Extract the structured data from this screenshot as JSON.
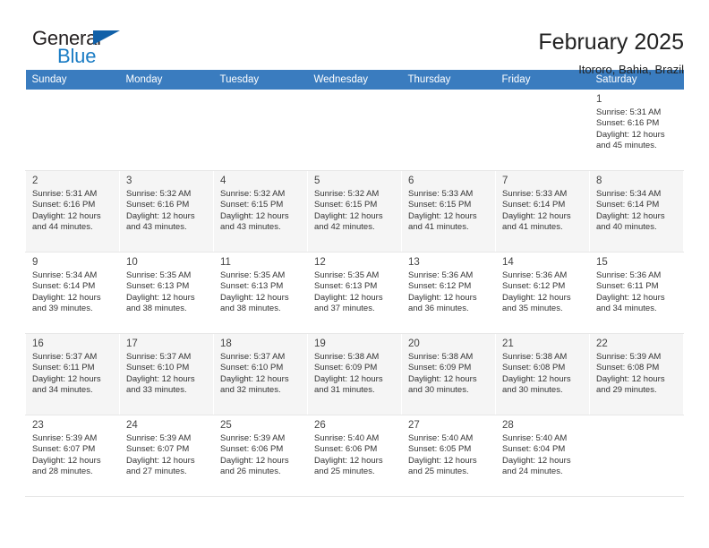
{
  "brand": {
    "name_part1": "General",
    "name_part2": "Blue",
    "logo_icon": "blue-triangle-logo"
  },
  "header": {
    "title": "February 2025",
    "subtitle": "Itororo, Bahia, Brazil"
  },
  "colors": {
    "header_row_bg": "#3a7cbf",
    "brand_blue": "#1a7cc4",
    "shaded_row_bg": "#f5f5f5",
    "cell_border": "#e7e7e7"
  },
  "weekday_headers": [
    "Sunday",
    "Monday",
    "Tuesday",
    "Wednesday",
    "Thursday",
    "Friday",
    "Saturday"
  ],
  "weeks": [
    {
      "shaded": false,
      "days": [
        {
          "day": "",
          "sunrise": "",
          "sunset": "",
          "daylight_line1": "",
          "daylight_line2": "",
          "empty": true
        },
        {
          "day": "",
          "sunrise": "",
          "sunset": "",
          "daylight_line1": "",
          "daylight_line2": "",
          "empty": true
        },
        {
          "day": "",
          "sunrise": "",
          "sunset": "",
          "daylight_line1": "",
          "daylight_line2": "",
          "empty": true
        },
        {
          "day": "",
          "sunrise": "",
          "sunset": "",
          "daylight_line1": "",
          "daylight_line2": "",
          "empty": true
        },
        {
          "day": "",
          "sunrise": "",
          "sunset": "",
          "daylight_line1": "",
          "daylight_line2": "",
          "empty": true
        },
        {
          "day": "",
          "sunrise": "",
          "sunset": "",
          "daylight_line1": "",
          "daylight_line2": "",
          "empty": true
        },
        {
          "day": "1",
          "sunrise": "Sunrise: 5:31 AM",
          "sunset": "Sunset: 6:16 PM",
          "daylight_line1": "Daylight: 12 hours",
          "daylight_line2": "and 45 minutes.",
          "empty": false
        }
      ]
    },
    {
      "shaded": true,
      "days": [
        {
          "day": "2",
          "sunrise": "Sunrise: 5:31 AM",
          "sunset": "Sunset: 6:16 PM",
          "daylight_line1": "Daylight: 12 hours",
          "daylight_line2": "and 44 minutes.",
          "empty": false
        },
        {
          "day": "3",
          "sunrise": "Sunrise: 5:32 AM",
          "sunset": "Sunset: 6:16 PM",
          "daylight_line1": "Daylight: 12 hours",
          "daylight_line2": "and 43 minutes.",
          "empty": false
        },
        {
          "day": "4",
          "sunrise": "Sunrise: 5:32 AM",
          "sunset": "Sunset: 6:15 PM",
          "daylight_line1": "Daylight: 12 hours",
          "daylight_line2": "and 43 minutes.",
          "empty": false
        },
        {
          "day": "5",
          "sunrise": "Sunrise: 5:32 AM",
          "sunset": "Sunset: 6:15 PM",
          "daylight_line1": "Daylight: 12 hours",
          "daylight_line2": "and 42 minutes.",
          "empty": false
        },
        {
          "day": "6",
          "sunrise": "Sunrise: 5:33 AM",
          "sunset": "Sunset: 6:15 PM",
          "daylight_line1": "Daylight: 12 hours",
          "daylight_line2": "and 41 minutes.",
          "empty": false
        },
        {
          "day": "7",
          "sunrise": "Sunrise: 5:33 AM",
          "sunset": "Sunset: 6:14 PM",
          "daylight_line1": "Daylight: 12 hours",
          "daylight_line2": "and 41 minutes.",
          "empty": false
        },
        {
          "day": "8",
          "sunrise": "Sunrise: 5:34 AM",
          "sunset": "Sunset: 6:14 PM",
          "daylight_line1": "Daylight: 12 hours",
          "daylight_line2": "and 40 minutes.",
          "empty": false
        }
      ]
    },
    {
      "shaded": false,
      "days": [
        {
          "day": "9",
          "sunrise": "Sunrise: 5:34 AM",
          "sunset": "Sunset: 6:14 PM",
          "daylight_line1": "Daylight: 12 hours",
          "daylight_line2": "and 39 minutes.",
          "empty": false
        },
        {
          "day": "10",
          "sunrise": "Sunrise: 5:35 AM",
          "sunset": "Sunset: 6:13 PM",
          "daylight_line1": "Daylight: 12 hours",
          "daylight_line2": "and 38 minutes.",
          "empty": false
        },
        {
          "day": "11",
          "sunrise": "Sunrise: 5:35 AM",
          "sunset": "Sunset: 6:13 PM",
          "daylight_line1": "Daylight: 12 hours",
          "daylight_line2": "and 38 minutes.",
          "empty": false
        },
        {
          "day": "12",
          "sunrise": "Sunrise: 5:35 AM",
          "sunset": "Sunset: 6:13 PM",
          "daylight_line1": "Daylight: 12 hours",
          "daylight_line2": "and 37 minutes.",
          "empty": false
        },
        {
          "day": "13",
          "sunrise": "Sunrise: 5:36 AM",
          "sunset": "Sunset: 6:12 PM",
          "daylight_line1": "Daylight: 12 hours",
          "daylight_line2": "and 36 minutes.",
          "empty": false
        },
        {
          "day": "14",
          "sunrise": "Sunrise: 5:36 AM",
          "sunset": "Sunset: 6:12 PM",
          "daylight_line1": "Daylight: 12 hours",
          "daylight_line2": "and 35 minutes.",
          "empty": false
        },
        {
          "day": "15",
          "sunrise": "Sunrise: 5:36 AM",
          "sunset": "Sunset: 6:11 PM",
          "daylight_line1": "Daylight: 12 hours",
          "daylight_line2": "and 34 minutes.",
          "empty": false
        }
      ]
    },
    {
      "shaded": true,
      "days": [
        {
          "day": "16",
          "sunrise": "Sunrise: 5:37 AM",
          "sunset": "Sunset: 6:11 PM",
          "daylight_line1": "Daylight: 12 hours",
          "daylight_line2": "and 34 minutes.",
          "empty": false
        },
        {
          "day": "17",
          "sunrise": "Sunrise: 5:37 AM",
          "sunset": "Sunset: 6:10 PM",
          "daylight_line1": "Daylight: 12 hours",
          "daylight_line2": "and 33 minutes.",
          "empty": false
        },
        {
          "day": "18",
          "sunrise": "Sunrise: 5:37 AM",
          "sunset": "Sunset: 6:10 PM",
          "daylight_line1": "Daylight: 12 hours",
          "daylight_line2": "and 32 minutes.",
          "empty": false
        },
        {
          "day": "19",
          "sunrise": "Sunrise: 5:38 AM",
          "sunset": "Sunset: 6:09 PM",
          "daylight_line1": "Daylight: 12 hours",
          "daylight_line2": "and 31 minutes.",
          "empty": false
        },
        {
          "day": "20",
          "sunrise": "Sunrise: 5:38 AM",
          "sunset": "Sunset: 6:09 PM",
          "daylight_line1": "Daylight: 12 hours",
          "daylight_line2": "and 30 minutes.",
          "empty": false
        },
        {
          "day": "21",
          "sunrise": "Sunrise: 5:38 AM",
          "sunset": "Sunset: 6:08 PM",
          "daylight_line1": "Daylight: 12 hours",
          "daylight_line2": "and 30 minutes.",
          "empty": false
        },
        {
          "day": "22",
          "sunrise": "Sunrise: 5:39 AM",
          "sunset": "Sunset: 6:08 PM",
          "daylight_line1": "Daylight: 12 hours",
          "daylight_line2": "and 29 minutes.",
          "empty": false
        }
      ]
    },
    {
      "shaded": false,
      "days": [
        {
          "day": "23",
          "sunrise": "Sunrise: 5:39 AM",
          "sunset": "Sunset: 6:07 PM",
          "daylight_line1": "Daylight: 12 hours",
          "daylight_line2": "and 28 minutes.",
          "empty": false
        },
        {
          "day": "24",
          "sunrise": "Sunrise: 5:39 AM",
          "sunset": "Sunset: 6:07 PM",
          "daylight_line1": "Daylight: 12 hours",
          "daylight_line2": "and 27 minutes.",
          "empty": false
        },
        {
          "day": "25",
          "sunrise": "Sunrise: 5:39 AM",
          "sunset": "Sunset: 6:06 PM",
          "daylight_line1": "Daylight: 12 hours",
          "daylight_line2": "and 26 minutes.",
          "empty": false
        },
        {
          "day": "26",
          "sunrise": "Sunrise: 5:40 AM",
          "sunset": "Sunset: 6:06 PM",
          "daylight_line1": "Daylight: 12 hours",
          "daylight_line2": "and 25 minutes.",
          "empty": false
        },
        {
          "day": "27",
          "sunrise": "Sunrise: 5:40 AM",
          "sunset": "Sunset: 6:05 PM",
          "daylight_line1": "Daylight: 12 hours",
          "daylight_line2": "and 25 minutes.",
          "empty": false
        },
        {
          "day": "28",
          "sunrise": "Sunrise: 5:40 AM",
          "sunset": "Sunset: 6:04 PM",
          "daylight_line1": "Daylight: 12 hours",
          "daylight_line2": "and 24 minutes.",
          "empty": false
        },
        {
          "day": "",
          "sunrise": "",
          "sunset": "",
          "daylight_line1": "",
          "daylight_line2": "",
          "empty": true
        }
      ]
    }
  ]
}
